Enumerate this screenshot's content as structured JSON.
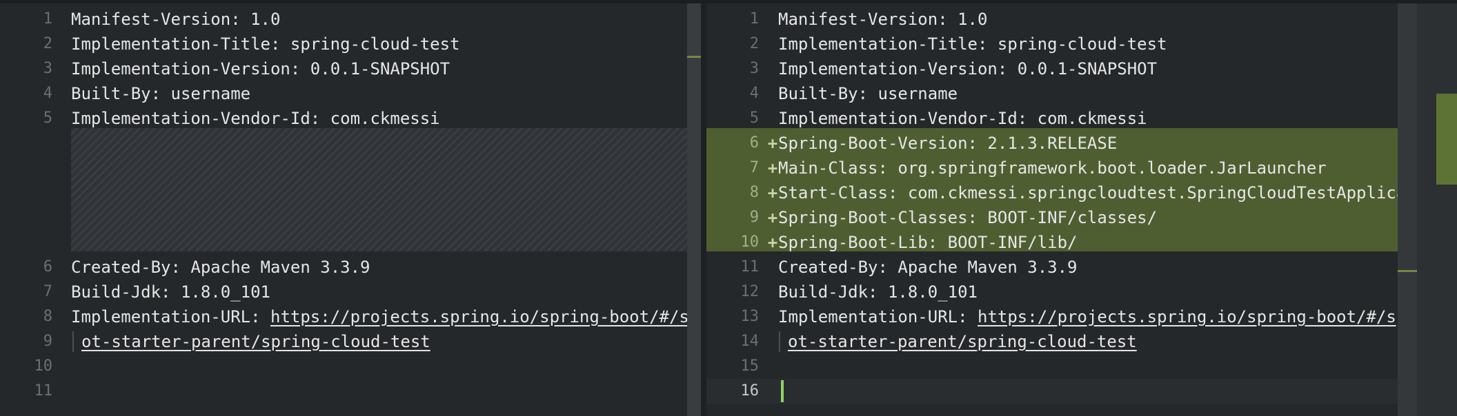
{
  "left": {
    "lines": [
      {
        "num": "1",
        "key": "Manifest-Version:",
        "value": " 1.0"
      },
      {
        "num": "2",
        "key": "Implementation-Title:",
        "value": " spring-cloud-test"
      },
      {
        "num": "3",
        "key": "Implementation-Version:",
        "value": " 0.0.1-SNAPSHOT"
      },
      {
        "num": "4",
        "key": "Built-By:",
        "value": " username"
      },
      {
        "num": "5",
        "key": "Implementation-Vendor-Id:",
        "value": " com.ckmessi"
      },
      {
        "num": "6",
        "key": "Created-By:",
        "value": " Apache Maven 3.3.9"
      },
      {
        "num": "7",
        "key": "Build-Jdk:",
        "value": " 1.8.0_101"
      },
      {
        "num": "8",
        "key": "Implementation-URL:",
        "value": "https://projects.spring.io/spring-boot/#/spr"
      },
      {
        "num": "9",
        "key": "",
        "value": "ot-starter-parent/spring-cloud-test"
      },
      {
        "num": "10",
        "key": "",
        "value": ""
      },
      {
        "num": "11",
        "key": "",
        "value": ""
      }
    ]
  },
  "right": {
    "lines": [
      {
        "num": "1",
        "key": "Manifest-Version:",
        "value": " 1.0"
      },
      {
        "num": "2",
        "key": "Implementation-Title:",
        "value": " spring-cloud-test"
      },
      {
        "num": "3",
        "key": "Implementation-Version:",
        "value": " 0.0.1-SNAPSHOT"
      },
      {
        "num": "4",
        "key": "Built-By:",
        "value": " username"
      },
      {
        "num": "5",
        "key": "Implementation-Vendor-Id:",
        "value": " com.ckmessi"
      },
      {
        "num": "6",
        "key": "Spring-Boot-Version:",
        "value": " 2.1.3.RELEASE",
        "marker": "+"
      },
      {
        "num": "7",
        "key": "Main-Class:",
        "value": " org.springframework.boot.loader.JarLauncher",
        "marker": "+"
      },
      {
        "num": "8",
        "key": "Start-Class:",
        "value": " com.ckmessi.springcloudtest.SpringCloudTestApplicat",
        "marker": "+"
      },
      {
        "num": "9",
        "key": "Spring-Boot-Classes:",
        "value": " BOOT-INF/classes/",
        "marker": "+"
      },
      {
        "num": "10",
        "key": "Spring-Boot-Lib:",
        "value": " BOOT-INF/lib/",
        "marker": "+"
      },
      {
        "num": "11",
        "key": "Created-By:",
        "value": " Apache Maven 3.3.9"
      },
      {
        "num": "12",
        "key": "Build-Jdk:",
        "value": " 1.8.0_101"
      },
      {
        "num": "13",
        "key": "Implementation-URL:",
        "value": "https://projects.spring.io/spring-boot/#/spr"
      },
      {
        "num": "14",
        "key": "",
        "value": "ot-starter-parent/spring-cloud-test"
      },
      {
        "num": "15",
        "key": "",
        "value": ""
      },
      {
        "num": "16",
        "key": "",
        "value": ""
      }
    ]
  },
  "colors": {
    "added_bg": "#4f5e31",
    "caret": "#8fd16a",
    "editor_bg": "#25282b"
  }
}
